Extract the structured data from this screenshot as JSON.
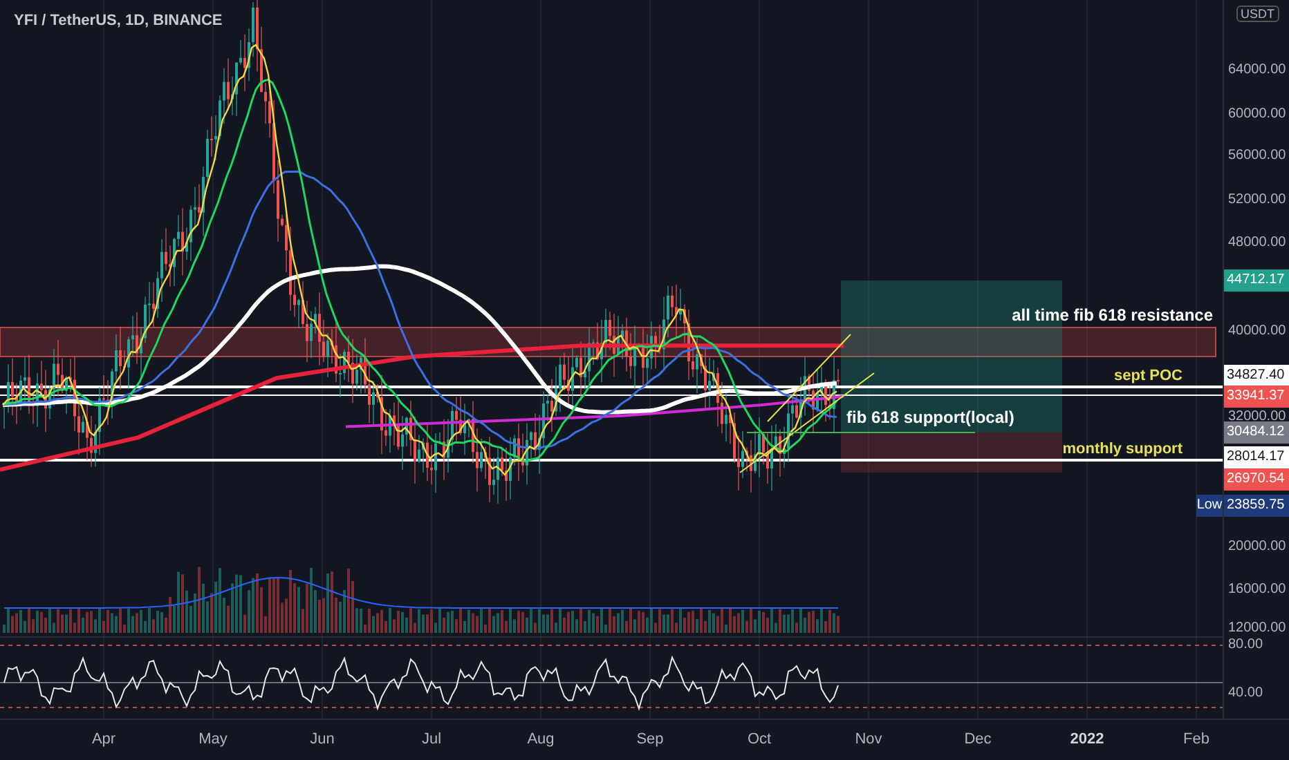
{
  "chart_header": {
    "title": "YFI / TetherUS, 1D, BINANCE"
  },
  "annotations": [
    {
      "text": "all time fib 618 resistance",
      "color": "#ffffff"
    },
    {
      "text": "sept POC",
      "color": "#e8e05a"
    },
    {
      "text": "fib 618 support(local)",
      "color": "#ffffff"
    },
    {
      "text": "monthly support",
      "color": "#e8e05a"
    }
  ],
  "price_scale": {
    "currency": "USDT",
    "ticks": [
      "64000.00",
      "60000.00",
      "56000.00",
      "52000.00",
      "48000.00",
      "40000.00",
      "32000.00",
      "20000.00",
      "16000.00",
      "12000.00"
    ]
  },
  "price_badges": [
    {
      "text": "44712.17",
      "color": "#22a08c"
    },
    {
      "text": "34827.40",
      "color": "#ffffff"
    },
    {
      "text": "33941.37",
      "color": "#f0524f"
    },
    {
      "text": "30484.12",
      "color": "#787b86"
    },
    {
      "text": "28014.17",
      "color": "#ffffff"
    },
    {
      "text": "26970.54",
      "color": "#f0524f"
    },
    {
      "text": "23859.75",
      "color": "#1e3a7a",
      "label": "Low"
    }
  ],
  "rsi_scale": {
    "ticks": [
      "80.00",
      "40.00"
    ]
  },
  "time_axis": [
    {
      "text": "Apr",
      "kind": "month"
    },
    {
      "text": "May",
      "kind": "month"
    },
    {
      "text": "Jun",
      "kind": "month"
    },
    {
      "text": "Jul",
      "kind": "month"
    },
    {
      "text": "Aug",
      "kind": "month"
    },
    {
      "text": "Sep",
      "kind": "month"
    },
    {
      "text": "Oct",
      "kind": "month"
    },
    {
      "text": "Nov",
      "kind": "month"
    },
    {
      "text": "Dec",
      "kind": "month"
    },
    {
      "text": "2022",
      "kind": "year"
    },
    {
      "text": "Feb",
      "kind": "month"
    }
  ]
}
